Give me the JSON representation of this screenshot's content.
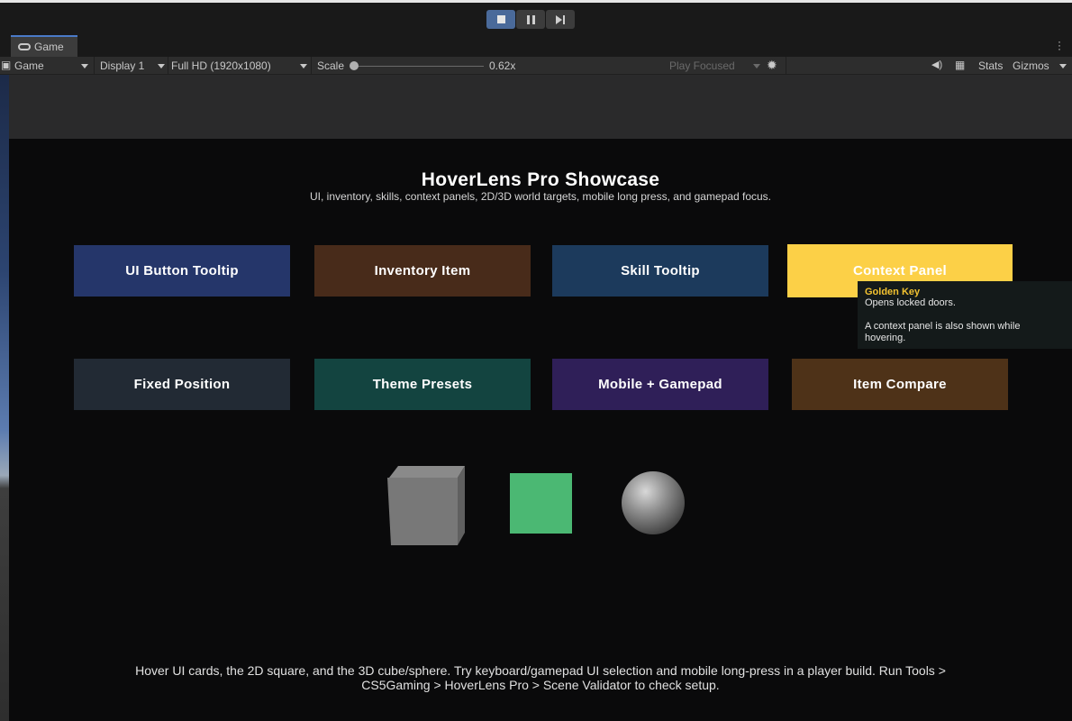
{
  "toolbar": {
    "play_buttons": [
      "stop",
      "pause",
      "step"
    ]
  },
  "tab": {
    "label": "Game"
  },
  "game_toolbar": {
    "view_mode": "Game",
    "display": "Display 1",
    "resolution": "Full HD (1920x1080)",
    "scale_label": "Scale",
    "scale_value": "0.62x",
    "scale_fraction": 0.0,
    "play_mode": "Play Focused",
    "stats_label": "Stats",
    "gizmos_label": "Gizmos"
  },
  "showcase": {
    "title": "HoverLens Pro Showcase",
    "subtitle": "UI, inventory, skills, context panels, 2D/3D world targets, mobile long press, and gamepad focus.",
    "cards": [
      {
        "label": "UI Button Tooltip",
        "color": "#25366a"
      },
      {
        "label": "Inventory Item",
        "color": "#482b1a"
      },
      {
        "label": "Skill Tooltip",
        "color": "#1c3a5c"
      },
      {
        "label": "Context Panel",
        "color": "#fcd047"
      },
      {
        "label": "Fixed Position",
        "color": "#222a34"
      },
      {
        "label": "Theme Presets",
        "color": "#134440"
      },
      {
        "label": "Mobile + Gamepad",
        "color": "#2f1f58"
      },
      {
        "label": "Item Compare",
        "color": "#4e3218"
      }
    ],
    "tooltip": {
      "title": "Golden Key",
      "body": "Opens locked doors.\n\nA context panel is also shown while hovering."
    },
    "footer": "Hover UI cards, the 2D square, and the 3D cube/sphere. Try keyboard/gamepad UI selection and mobile long-press in a player build. Run Tools > CS5Gaming > HoverLens Pro > Scene Validator to check setup."
  },
  "colors": {
    "accent_blue": "#4a6a9a",
    "tooltip_title": "#f2c230",
    "square_2d": "#4bb873",
    "cube": "#7a7a7a"
  }
}
